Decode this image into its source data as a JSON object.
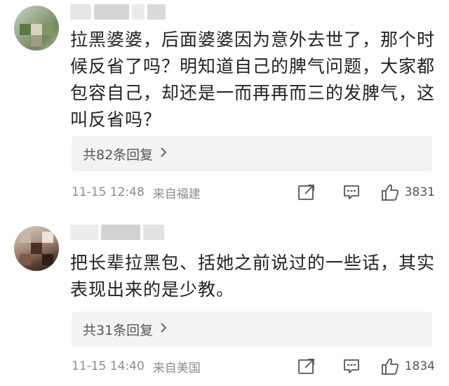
{
  "comments": [
    {
      "text": "拉黑婆婆，后面婆婆因为意外去世了，那个时候反省了吗？明知道自己的脾气问题，大家都包容自己，却还是一而再再而三的发脾气，这叫反省吗？",
      "replies_label": "共82条回复",
      "time": "11-15 12:48",
      "location": "来自福建",
      "likes": "3831"
    },
    {
      "text": "把长辈拉黑包、括她之前说过的一些话，其实表现出来的是少教。",
      "replies_label": "共31条回复",
      "time": "11-15 14:40",
      "location": "来自美国",
      "likes": "1834"
    }
  ],
  "icons": {
    "share": "share-icon",
    "comment": "comment-icon",
    "like": "thumbs-up-icon"
  },
  "colors": {
    "text": "#222222",
    "meta": "#8c8c8c",
    "reply_bg": "#f3f3f4"
  }
}
